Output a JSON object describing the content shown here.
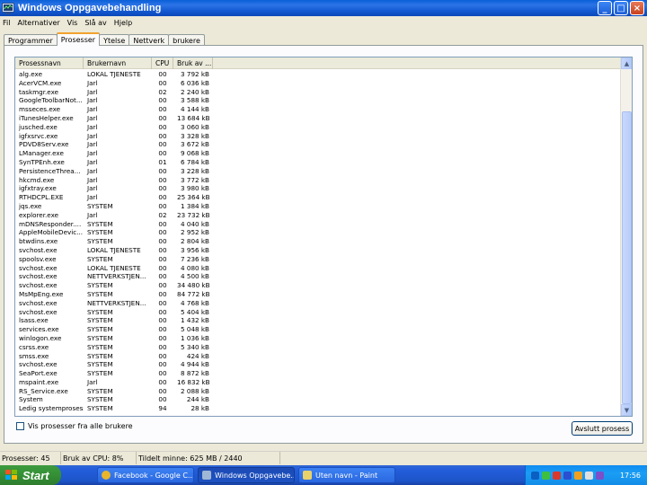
{
  "window": {
    "title": "Windows Oppgavebehandling"
  },
  "menu": [
    "Fil",
    "Alternativer",
    "Vis",
    "Slå av",
    "Hjelp"
  ],
  "tabs": [
    {
      "label": "Programmer"
    },
    {
      "label": "Prosesser",
      "active": true
    },
    {
      "label": "Ytelse"
    },
    {
      "label": "Nettverk"
    },
    {
      "label": "brukere"
    }
  ],
  "columns": [
    "Prosessnavn",
    "Brukernavn",
    "CPU",
    "Bruk av ..."
  ],
  "processes": [
    [
      "alg.exe",
      "LOKAL TJENESTE",
      "00",
      "3 792 kB"
    ],
    [
      "AcerVCM.exe",
      "Jarl",
      "00",
      "6 036 kB"
    ],
    [
      "taskmgr.exe",
      "Jarl",
      "02",
      "2 240 kB"
    ],
    [
      "GoogleToolbarNot...",
      "Jarl",
      "00",
      "3 588 kB"
    ],
    [
      "msseces.exe",
      "Jarl",
      "00",
      "4 144 kB"
    ],
    [
      "iTunesHelper.exe",
      "Jarl",
      "00",
      "13 684 kB"
    ],
    [
      "jusched.exe",
      "Jarl",
      "00",
      "3 060 kB"
    ],
    [
      "igfxsrvc.exe",
      "Jarl",
      "00",
      "3 328 kB"
    ],
    [
      "PDVD8Serv.exe",
      "Jarl",
      "00",
      "3 672 kB"
    ],
    [
      "LManager.exe",
      "Jarl",
      "00",
      "9 068 kB"
    ],
    [
      "SynTPEnh.exe",
      "Jarl",
      "01",
      "6 784 kB"
    ],
    [
      "PersistenceThrea...",
      "Jarl",
      "00",
      "3 228 kB"
    ],
    [
      "hkcmd.exe",
      "Jarl",
      "00",
      "3 772 kB"
    ],
    [
      "igfxtray.exe",
      "Jarl",
      "00",
      "3 980 kB"
    ],
    [
      "RTHDCPL.EXE",
      "Jarl",
      "00",
      "25 364 kB"
    ],
    [
      "jqs.exe",
      "SYSTEM",
      "00",
      "1 384 kB"
    ],
    [
      "explorer.exe",
      "Jarl",
      "02",
      "23 732 kB"
    ],
    [
      "mDNSResponder....",
      "SYSTEM",
      "00",
      "4 040 kB"
    ],
    [
      "AppleMobileDevic...",
      "SYSTEM",
      "00",
      "2 952 kB"
    ],
    [
      "btwdins.exe",
      "SYSTEM",
      "00",
      "2 804 kB"
    ],
    [
      "svchost.exe",
      "LOKAL TJENESTE",
      "00",
      "3 956 kB"
    ],
    [
      "spoolsv.exe",
      "SYSTEM",
      "00",
      "7 236 kB"
    ],
    [
      "svchost.exe",
      "LOKAL TJENESTE",
      "00",
      "4 080 kB"
    ],
    [
      "svchost.exe",
      "NETTVERKSTJEN...",
      "00",
      "4 500 kB"
    ],
    [
      "svchost.exe",
      "SYSTEM",
      "00",
      "34 480 kB"
    ],
    [
      "MsMpEng.exe",
      "SYSTEM",
      "00",
      "84 772 kB"
    ],
    [
      "svchost.exe",
      "NETTVERKSTJEN...",
      "00",
      "4 768 kB"
    ],
    [
      "svchost.exe",
      "SYSTEM",
      "00",
      "5 404 kB"
    ],
    [
      "lsass.exe",
      "SYSTEM",
      "00",
      "1 432 kB"
    ],
    [
      "services.exe",
      "SYSTEM",
      "00",
      "5 048 kB"
    ],
    [
      "winlogon.exe",
      "SYSTEM",
      "00",
      "1 036 kB"
    ],
    [
      "csrss.exe",
      "SYSTEM",
      "00",
      "5 340 kB"
    ],
    [
      "smss.exe",
      "SYSTEM",
      "00",
      "424 kB"
    ],
    [
      "svchost.exe",
      "SYSTEM",
      "00",
      "4 944 kB"
    ],
    [
      "SeaPort.exe",
      "SYSTEM",
      "00",
      "8 872 kB"
    ],
    [
      "mspaint.exe",
      "Jarl",
      "00",
      "16 832 kB"
    ],
    [
      "RS_Service.exe",
      "SYSTEM",
      "00",
      "2 088 kB"
    ],
    [
      "System",
      "SYSTEM",
      "00",
      "244 kB"
    ],
    [
      "Ledig systemprosess",
      "SYSTEM",
      "94",
      "28 kB"
    ]
  ],
  "show_all_label": "Vis prosesser fra alle brukere",
  "end_process_label": "Avslutt prosess",
  "status": {
    "processes": "Prosesser: 45",
    "cpu": "Bruk av CPU: 8%",
    "memory": "Tildelt minne: 625 MB / 2440"
  },
  "taskbar": {
    "start_label": "Start",
    "tasks": [
      {
        "label": "Facebook - Google C...",
        "icon": "chrome-icon",
        "color": "#e8b52a"
      },
      {
        "label": "Windows Oppgavebe...",
        "icon": "taskmgr-icon",
        "color": "#9fb6d6",
        "active": true
      },
      {
        "label": "Uten navn - Paint",
        "icon": "paint-icon",
        "color": "#e8d26a"
      }
    ],
    "clock": "17:56"
  }
}
